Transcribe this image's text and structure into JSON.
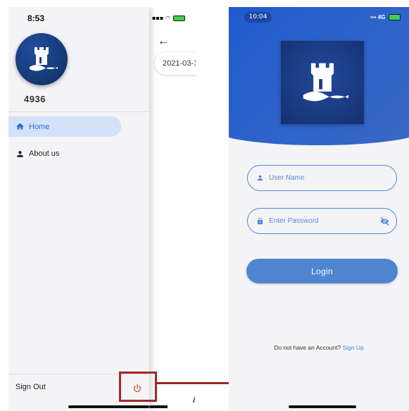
{
  "left_screen": {
    "status_time": "8:53",
    "username": "4936",
    "nav_items": [
      {
        "label": "Home",
        "icon": "home-icon",
        "active": true
      },
      {
        "label": "About us",
        "icon": "person-icon",
        "active": false
      }
    ],
    "sign_out_label": "Sign Out",
    "behind_page": {
      "date_chip": "2021-03-1"
    }
  },
  "right_screen": {
    "status_time": "10:04",
    "network": "4G",
    "username_placeholder": "User Name",
    "password_placeholder": "Enter Password",
    "login_label": "Login",
    "signup_prompt": "Do not have an Account?",
    "signup_link": "Sign Up"
  },
  "colors": {
    "accent": "#2a6fcf",
    "hero": "#1e59cf",
    "login_button": "#4f86d2",
    "power_icon": "#e2554a",
    "highlight": "#a32727"
  }
}
